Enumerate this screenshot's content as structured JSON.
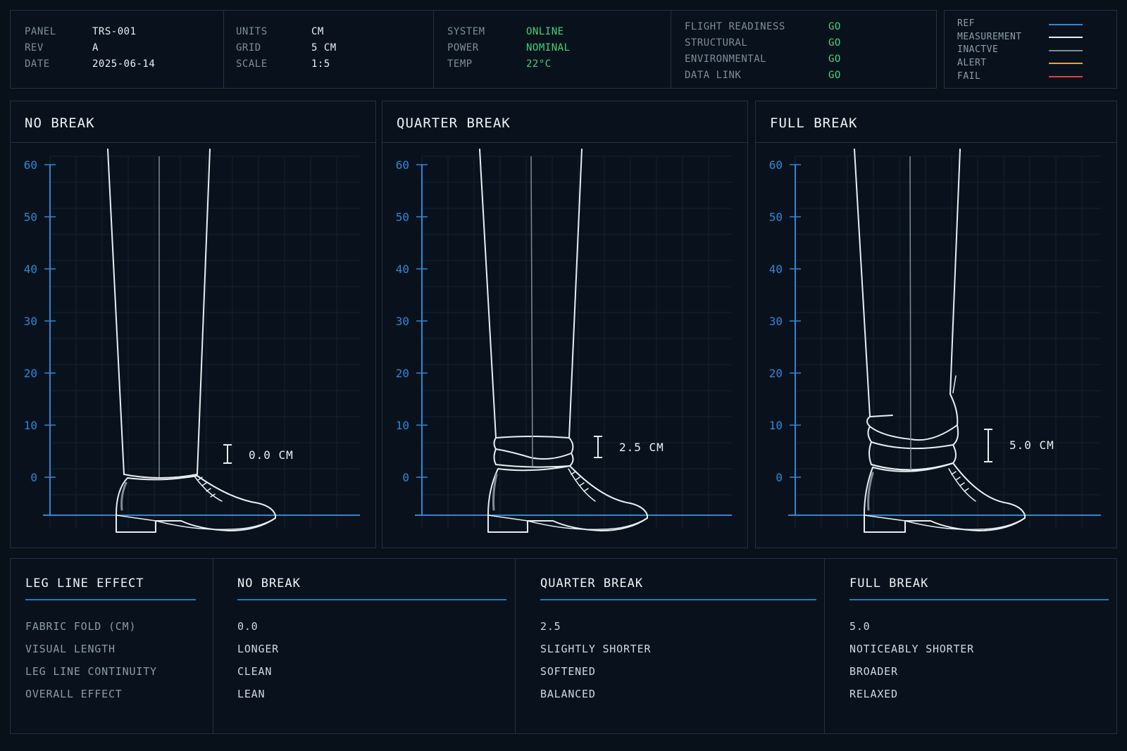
{
  "header": {
    "col1": [
      {
        "label": "PANEL",
        "value": "TRS-001"
      },
      {
        "label": "REV",
        "value": "A"
      },
      {
        "label": "DATE",
        "value": "2025-06-14"
      }
    ],
    "col2": [
      {
        "label": "UNITS",
        "value": "CM"
      },
      {
        "label": "GRID",
        "value": "5 CM"
      },
      {
        "label": "SCALE",
        "value": "1:5"
      }
    ],
    "col3": [
      {
        "label": "SYSTEM",
        "value": "ONLINE"
      },
      {
        "label": "POWER",
        "value": "NOMINAL"
      },
      {
        "label": "TEMP",
        "value": "22°C"
      }
    ],
    "col4": [
      {
        "label": "FLIGHT READINESS",
        "value": "GO"
      },
      {
        "label": "STRUCTURAL",
        "value": "GO"
      },
      {
        "label": "ENVIRONMENTAL",
        "value": "GO"
      },
      {
        "label": "DATA LINK",
        "value": "GO"
      }
    ]
  },
  "legend": [
    {
      "label": "REF",
      "color": "#2f86d6"
    },
    {
      "label": "MEASUREMENT",
      "color": "#e8eef3"
    },
    {
      "label": "INACTVE",
      "color": "#7f8c96"
    },
    {
      "label": "ALERT",
      "color": "#e8a23a"
    },
    {
      "label": "FAIL",
      "color": "#e0413a"
    }
  ],
  "panels": [
    {
      "title": "NO BREAK",
      "measure": "0.0 CM"
    },
    {
      "title": "QUARTER BREAK",
      "measure": "2.5 CM"
    },
    {
      "title": "FULL BREAK",
      "measure": "5.0 CM"
    }
  ],
  "axis_ticks": [
    "60",
    "50",
    "40",
    "30",
    "20",
    "10",
    "0"
  ],
  "table": {
    "title": "LEG LINE EFFECT",
    "columns": [
      "NO BREAK",
      "QUARTER BREAK",
      "FULL BREAK"
    ],
    "row_labels": [
      "FABRIC FOLD (CM)",
      "VISUAL LENGTH",
      "LEG LINE CONTINUITY",
      "OVERALL EFFECT"
    ],
    "rows": [
      [
        "0.0",
        "LONGER",
        "CLEAN",
        "LEAN"
      ],
      [
        "2.5",
        "SLIGHTLY SHORTER",
        "SOFTENED",
        "BALANCED"
      ],
      [
        "5.0",
        "NOTICEABLY SHORTER",
        "BROADER",
        "RELAXED"
      ]
    ]
  },
  "colors": {
    "accent": "#2f86d6",
    "go": "#3fd47a",
    "line": "#e8eef3",
    "background": "#081019"
  }
}
